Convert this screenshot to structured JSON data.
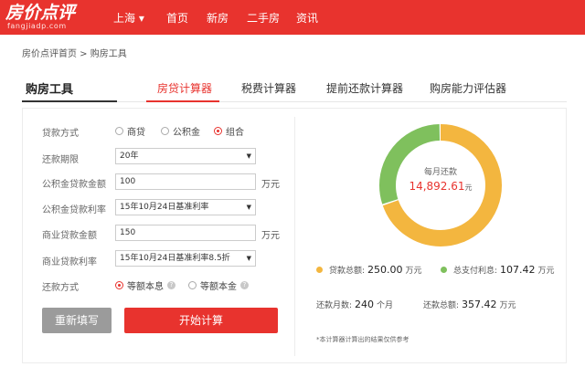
{
  "header": {
    "logo_text": "房价点评",
    "logo_sub": "fangjiadp.com",
    "city": "上海 ▾",
    "nav": [
      "首页",
      "新房",
      "二手房",
      "资讯"
    ]
  },
  "breadcrumb": "房价点评首页 > 购房工具",
  "tools_title": "购房工具",
  "tabs": [
    "房贷计算器",
    "税费计算器",
    "提前还款计算器",
    "购房能力评估器"
  ],
  "form": {
    "loan_type_label": "贷款方式",
    "loan_type_options": [
      "商贷",
      "公积金",
      "组合"
    ],
    "term_label": "还款期限",
    "term_value": "20年",
    "fund_amount_label": "公积金贷款金额",
    "fund_amount_value": "100",
    "fund_rate_label": "公积金贷款利率",
    "fund_rate_value": "15年10月24日基准利率",
    "biz_amount_label": "商业贷款金额",
    "biz_amount_value": "150",
    "biz_rate_label": "商业贷款利率",
    "biz_rate_value": "15年10月24日基准利率8.5折",
    "repay_label": "还款方式",
    "repay_options": [
      "等额本息",
      "等额本金"
    ],
    "unit": "万元",
    "help_icon_text": "?",
    "reset_label": "重新填写",
    "calc_label": "开始计算"
  },
  "result": {
    "monthly_label": "每月还款",
    "monthly_value": "14,892.61",
    "monthly_unit": "元",
    "total_loan_label": "贷款总额:",
    "total_loan_value": "250.00",
    "total_loan_unit": "万元",
    "total_interest_label": "总支付利息:",
    "total_interest_value": "107.42",
    "total_interest_unit": "万元",
    "months_label": "还款月数:",
    "months_value": "240",
    "months_unit": "个月",
    "total_repay_label": "还款总额:",
    "total_repay_value": "357.42",
    "total_repay_unit": "万元",
    "note": "*本计算器计算出的结果仅供参考"
  },
  "chart_data": {
    "type": "pie",
    "categories": [
      "贷款总额",
      "总支付利息"
    ],
    "values": [
      250.0,
      107.42
    ],
    "colors": [
      "#f3b63f",
      "#7fc05d"
    ]
  }
}
